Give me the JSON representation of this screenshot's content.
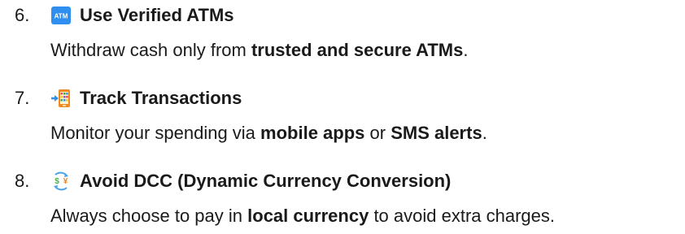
{
  "items": [
    {
      "number": "6.",
      "icon": "atm-sign-icon",
      "icon_text": "ATM",
      "title": "Use Verified ATMs",
      "desc": [
        "Withdraw cash only from ",
        "trusted and secure ATMs",
        "."
      ]
    },
    {
      "number": "7.",
      "icon": "mobile-phone-with-arrow-icon",
      "title": "Track Transactions",
      "desc": [
        "Monitor your spending via ",
        "mobile apps",
        " or ",
        "SMS alerts",
        "."
      ]
    },
    {
      "number": "8.",
      "icon": "currency-exchange-icon",
      "icon_text": [
        "$",
        "¥"
      ],
      "title": "Avoid DCC (Dynamic Currency Conversion)",
      "desc": [
        "Always choose to pay in ",
        "local currency",
        " to avoid extra charges."
      ]
    }
  ],
  "colors": {
    "text": "#1a1a1a",
    "atm_blue": "#2f8ff0",
    "phone_orange": "#f08a1c",
    "arrow_blue": "#2f8ff0",
    "exchange_blue": "#4aa3e6",
    "dollar_green": "#4caf50",
    "yen_orange": "#e8872a"
  }
}
